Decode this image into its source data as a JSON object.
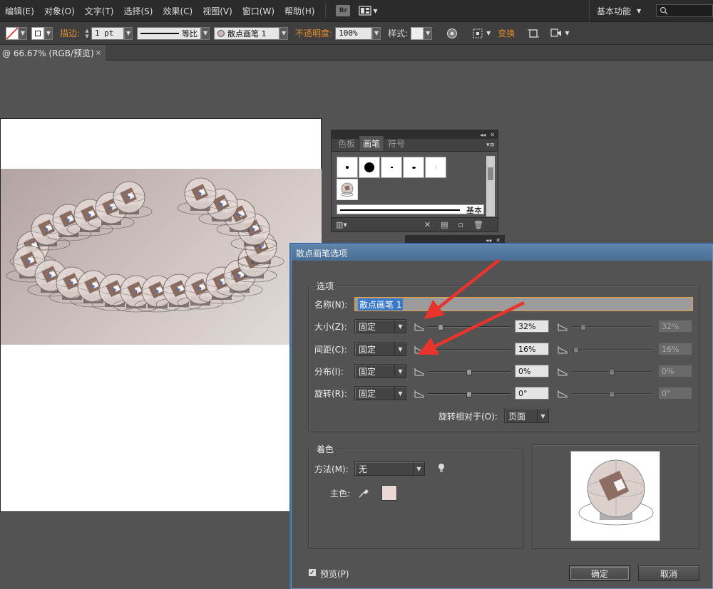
{
  "menubar": {
    "items": [
      "编辑(E)",
      "对象(O)",
      "文字(T)",
      "选择(S)",
      "效果(C)",
      "视图(V)",
      "窗口(W)",
      "帮助(H)"
    ],
    "bridge_badge": "Br",
    "workspace": "基本功能"
  },
  "controlbar": {
    "stroke_label": "描边:",
    "stroke_weight": "1 pt",
    "stroke_profile": "等比",
    "brush_name": "散点画笔 1",
    "opacity_label": "不透明度:",
    "opacity_value": "100%",
    "style_label": "样式:",
    "transform_label": "变换"
  },
  "document_tab": {
    "title": "@ 66.67% (RGB/预览)",
    "close": "×"
  },
  "brushes_panel": {
    "tabs": [
      "色板",
      "画笔",
      "符号"
    ],
    "active_tab": "画笔",
    "basic_label": "基本"
  },
  "dialog": {
    "title": "散点画笔选项",
    "options_group": "选项",
    "name_label": "名称(N):",
    "name_value": "散点画笔 1",
    "rows": [
      {
        "label": "大小(Z):",
        "mode": "固定",
        "value": "32%",
        "value2": "32%"
      },
      {
        "label": "间距(C):",
        "mode": "固定",
        "value": "16%",
        "value2": "16%"
      },
      {
        "label": "分布(I):",
        "mode": "固定",
        "value": "0%",
        "value2": "0%"
      },
      {
        "label": "旋转(R):",
        "mode": "固定",
        "value": "0°",
        "value2": "0°"
      }
    ],
    "rotation_relative_label": "旋转相对于(O):",
    "rotation_relative_value": "页面",
    "colorization_group": "着色",
    "method_label": "方法(M):",
    "method_value": "无",
    "key_color_label": "主色:",
    "key_color": "#ead8d6",
    "preview_label": "预览(P)",
    "preview_checked": true,
    "ok_label": "确定",
    "cancel_label": "取消"
  }
}
